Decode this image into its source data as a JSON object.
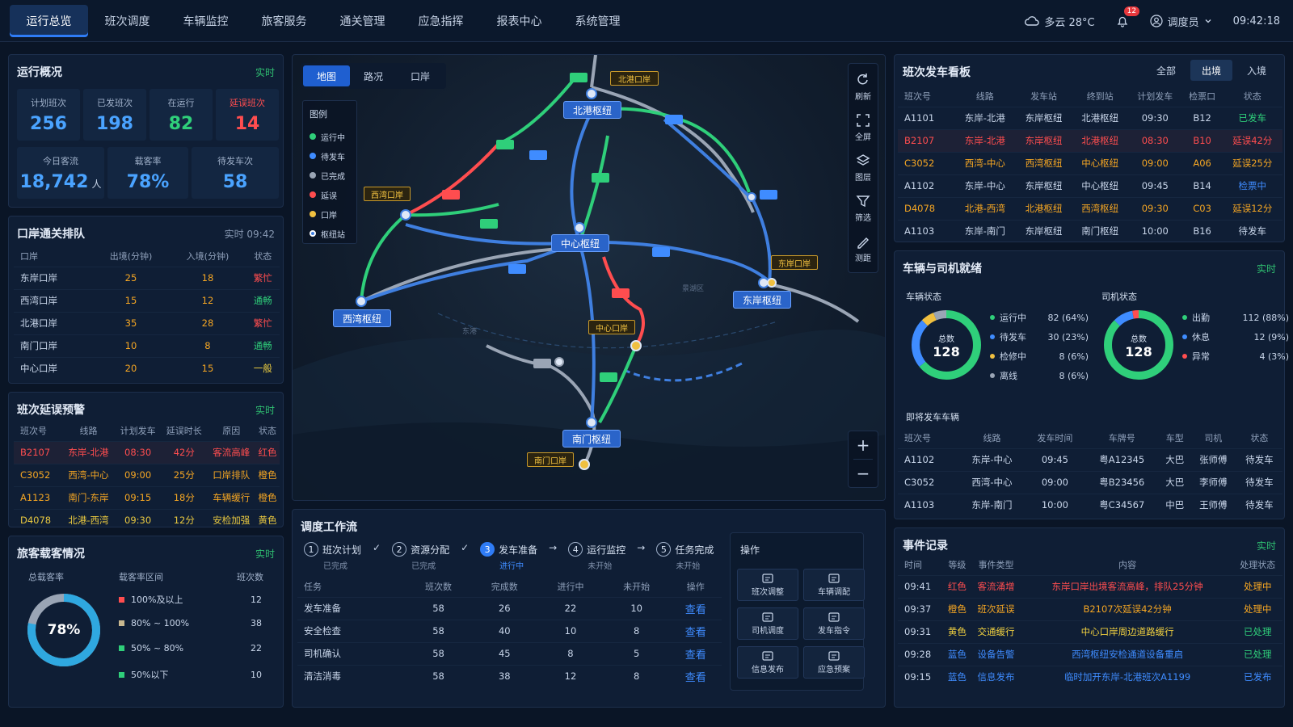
{
  "nav": [
    "运行总览",
    "班次调度",
    "车辆监控",
    "旅客服务",
    "通关管理",
    "应急指挥",
    "报表中心",
    "系统管理"
  ],
  "topright": {
    "weather": "多云 28°C",
    "badge": "12",
    "user": "调度员",
    "time": "09:42:18"
  },
  "overview": {
    "title": "运行概况",
    "tag": "实时",
    "row1": [
      {
        "label": "计划班次",
        "value": "256"
      },
      {
        "label": "已发班次",
        "value": "198"
      },
      {
        "label": "在运行",
        "value": "82"
      },
      {
        "label": "延误班次",
        "value": "14"
      }
    ],
    "row2": [
      {
        "label": "今日客流",
        "value": "18,742",
        "unit": "人"
      },
      {
        "label": "载客率",
        "value": "78%"
      },
      {
        "label": "待发车次",
        "value": "58"
      }
    ]
  },
  "port": {
    "title": "口岸通关排队",
    "tag": "实时 09:42",
    "headers": [
      "口岸",
      "出境(分钟)",
      "入境(分钟)",
      "状态"
    ],
    "rows": [
      [
        "东岸口岸",
        "25",
        "18",
        "繁忙"
      ],
      [
        "西湾口岸",
        "15",
        "12",
        "通畅"
      ],
      [
        "北港口岸",
        "35",
        "28",
        "繁忙"
      ],
      [
        "南门口岸",
        "10",
        "8",
        "通畅"
      ],
      [
        "中心口岸",
        "20",
        "15",
        "一般"
      ]
    ]
  },
  "delay": {
    "title": "班次延误预警",
    "tag": "实时",
    "headers": [
      "班次号",
      "线路",
      "计划发车",
      "延误时长",
      "原因",
      "状态"
    ],
    "rows": [
      [
        "B2107",
        "东岸-北港",
        "08:30",
        "42分",
        "客流高峰",
        "红色"
      ],
      [
        "C3052",
        "西湾-中心",
        "09:00",
        "25分",
        "口岸排队",
        "橙色"
      ],
      [
        "A1123",
        "南门-东岸",
        "09:15",
        "18分",
        "车辆缓行",
        "橙色"
      ],
      [
        "D4078",
        "北港-西湾",
        "09:30",
        "12分",
        "安检加强",
        "黄色"
      ]
    ]
  },
  "load": {
    "title": "旅客载客情况",
    "tag": "实时",
    "total_label": "总载客率",
    "range_label": "载客率区间",
    "count_label": "班次数",
    "percent": "78%",
    "percent_value": 0.78,
    "rows": [
      {
        "label": "100%及以上",
        "count": "12",
        "color": "#ff4d4f"
      },
      {
        "label": "80% ~ 100%",
        "count": "38",
        "color": "#c8b890"
      },
      {
        "label": "50% ~ 80%",
        "count": "22",
        "color": "#2fcf7a"
      },
      {
        "label": "50%以下",
        "count": "10",
        "color": "#2fcf7a"
      }
    ]
  },
  "map": {
    "tabs": [
      "地图",
      "路况",
      "口岸"
    ],
    "legend_title": "图例",
    "legend": [
      {
        "label": "运行中",
        "color": "#2fcf7a"
      },
      {
        "label": "待发车",
        "color": "#3f8cff"
      },
      {
        "label": "已完成",
        "color": "#9aa5b5"
      },
      {
        "label": "延误",
        "color": "#ff4d4f"
      },
      {
        "label": "口岸",
        "color": "#f0c040"
      },
      {
        "label": "枢纽站",
        "color": "#ffffff"
      }
    ],
    "hubs": [
      "北港枢纽",
      "中心枢纽",
      "西湾枢纽",
      "东岸枢纽",
      "南门枢纽"
    ],
    "ports": [
      "北港口岸",
      "西湾口岸",
      "东岸口岸",
      "中心口岸",
      "南门口岸"
    ],
    "tools": [
      "刷新",
      "全屏",
      "图层",
      "筛选",
      "测距"
    ],
    "faint": [
      "景湖区",
      "东港"
    ]
  },
  "workflow": {
    "title": "调度工作流",
    "steps": [
      {
        "num": "1",
        "label": "班次计划",
        "status": "已完成",
        "sep": "✓"
      },
      {
        "num": "2",
        "label": "资源分配",
        "status": "已完成",
        "sep": "✓"
      },
      {
        "num": "3",
        "label": "发车准备",
        "status": "进行中",
        "sep": "→"
      },
      {
        "num": "4",
        "label": "运行监控",
        "status": "未开始",
        "sep": "→"
      },
      {
        "num": "5",
        "label": "任务完成",
        "status": "未开始",
        "sep": ""
      }
    ],
    "headers": [
      "任务",
      "班次数",
      "完成数",
      "进行中",
      "未开始",
      "操作"
    ],
    "rows": [
      [
        "发车准备",
        "58",
        "26",
        "22",
        "10",
        "查看"
      ],
      [
        "安全检查",
        "58",
        "40",
        "10",
        "8",
        "查看"
      ],
      [
        "司机确认",
        "58",
        "45",
        "8",
        "5",
        "查看"
      ],
      [
        "清洁消毒",
        "58",
        "38",
        "12",
        "8",
        "查看"
      ]
    ],
    "op_title": "操作",
    "ops": [
      "班次调整",
      "车辆调配",
      "司机调度",
      "发车指令",
      "信息发布",
      "应急预案"
    ]
  },
  "board": {
    "title": "班次发车看板",
    "tabs": [
      "全部",
      "出境",
      "入境"
    ],
    "headers": [
      "班次号",
      "线路",
      "发车站",
      "终到站",
      "计划发车",
      "检票口",
      "状态"
    ],
    "rows": [
      [
        "A1101",
        "东岸-北港",
        "东岸枢纽",
        "北港枢纽",
        "09:30",
        "B12",
        "已发车"
      ],
      [
        "B2107",
        "东岸-北港",
        "东岸枢纽",
        "北港枢纽",
        "08:30",
        "B10",
        "延误42分"
      ],
      [
        "C3052",
        "西湾-中心",
        "西湾枢纽",
        "中心枢纽",
        "09:00",
        "A06",
        "延误25分"
      ],
      [
        "A1102",
        "东岸-中心",
        "东岸枢纽",
        "中心枢纽",
        "09:45",
        "B14",
        "检票中"
      ],
      [
        "D4078",
        "北港-西湾",
        "北港枢纽",
        "西湾枢纽",
        "09:30",
        "C03",
        "延误12分"
      ],
      [
        "A1103",
        "东岸-南门",
        "东岸枢纽",
        "南门枢纽",
        "10:00",
        "B16",
        "待发车"
      ]
    ]
  },
  "ready": {
    "title": "车辆与司机就绪",
    "tag": "实时",
    "vehicle_title": "车辆状态",
    "driver_title": "司机状态",
    "total_label": "总数",
    "total": "128",
    "vehicle": [
      {
        "label": "运行中",
        "value": "82 (64%)",
        "n": 82,
        "color": "#2fcf7a"
      },
      {
        "label": "待发车",
        "value": "30 (23%)",
        "n": 30,
        "color": "#3f8cff"
      },
      {
        "label": "检修中",
        "value": "8 (6%)",
        "n": 8,
        "color": "#f0c040"
      },
      {
        "label": "离线",
        "value": "8 (6%)",
        "n": 8,
        "color": "#9aa5b5"
      }
    ],
    "driver": [
      {
        "label": "出勤",
        "value": "112 (88%)",
        "n": 112,
        "color": "#2fcf7a"
      },
      {
        "label": "休息",
        "value": "12 (9%)",
        "n": 12,
        "color": "#3f8cff"
      },
      {
        "label": "异常",
        "value": "4 (3%)",
        "n": 4,
        "color": "#ff4d4f"
      }
    ],
    "upcoming_title": "即将发车车辆",
    "headers": [
      "班次号",
      "线路",
      "发车时间",
      "车牌号",
      "车型",
      "司机",
      "状态"
    ],
    "rows": [
      [
        "A1102",
        "东岸-中心",
        "09:45",
        "粤A12345",
        "大巴",
        "张师傅",
        "待发车"
      ],
      [
        "C3052",
        "西湾-中心",
        "09:00",
        "粤B23456",
        "大巴",
        "李师傅",
        "待发车"
      ],
      [
        "A1103",
        "东岸-南门",
        "10:00",
        "粤C34567",
        "中巴",
        "王师傅",
        "待发车"
      ]
    ]
  },
  "events": {
    "title": "事件记录",
    "tag": "实时",
    "headers": [
      "时间",
      "等级",
      "事件类型",
      "内容",
      "处理状态"
    ],
    "rows": [
      [
        "09:41",
        "红色",
        "客流涌增",
        "东岸口岸出境客流高峰，排队25分钟",
        "处理中"
      ],
      [
        "09:37",
        "橙色",
        "班次延误",
        "B2107次延误42分钟",
        "处理中"
      ],
      [
        "09:31",
        "黄色",
        "交通缓行",
        "中心口岸周边道路缓行",
        "已处理"
      ],
      [
        "09:28",
        "蓝色",
        "设备告警",
        "西湾枢纽安检通道设备重启",
        "已处理"
      ],
      [
        "09:15",
        "蓝色",
        "信息发布",
        "临时加开东岸-北港班次A1199",
        "已发布"
      ]
    ]
  }
}
